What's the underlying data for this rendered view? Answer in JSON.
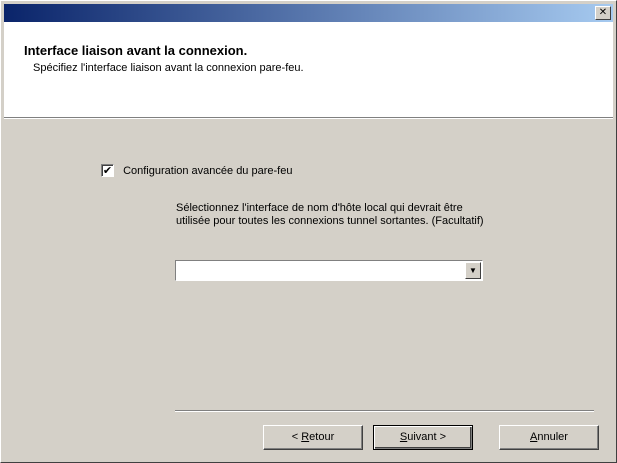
{
  "window": {
    "close_glyph": "✕"
  },
  "header": {
    "title": "Interface liaison avant la connexion.",
    "subtitle": "Spécifiez l'interface liaison avant la connexion pare-feu."
  },
  "options": {
    "advanced_firewall": {
      "label": "Configuration avancée du pare-feu",
      "checked": true,
      "check_glyph": "✔"
    },
    "description": "Sélectionnez l'interface de nom d'hôte local qui devrait être utilisée pour toutes les connexions tunnel sortantes.  (Facultatif)",
    "interface_select": {
      "value": "",
      "arrow_glyph": "▼"
    }
  },
  "buttons": {
    "back": {
      "prefix": "< ",
      "accel": "R",
      "rest": "etour"
    },
    "next": {
      "accel": "S",
      "rest": "uivant >"
    },
    "cancel": {
      "accel": "A",
      "rest": "nnuler"
    }
  }
}
